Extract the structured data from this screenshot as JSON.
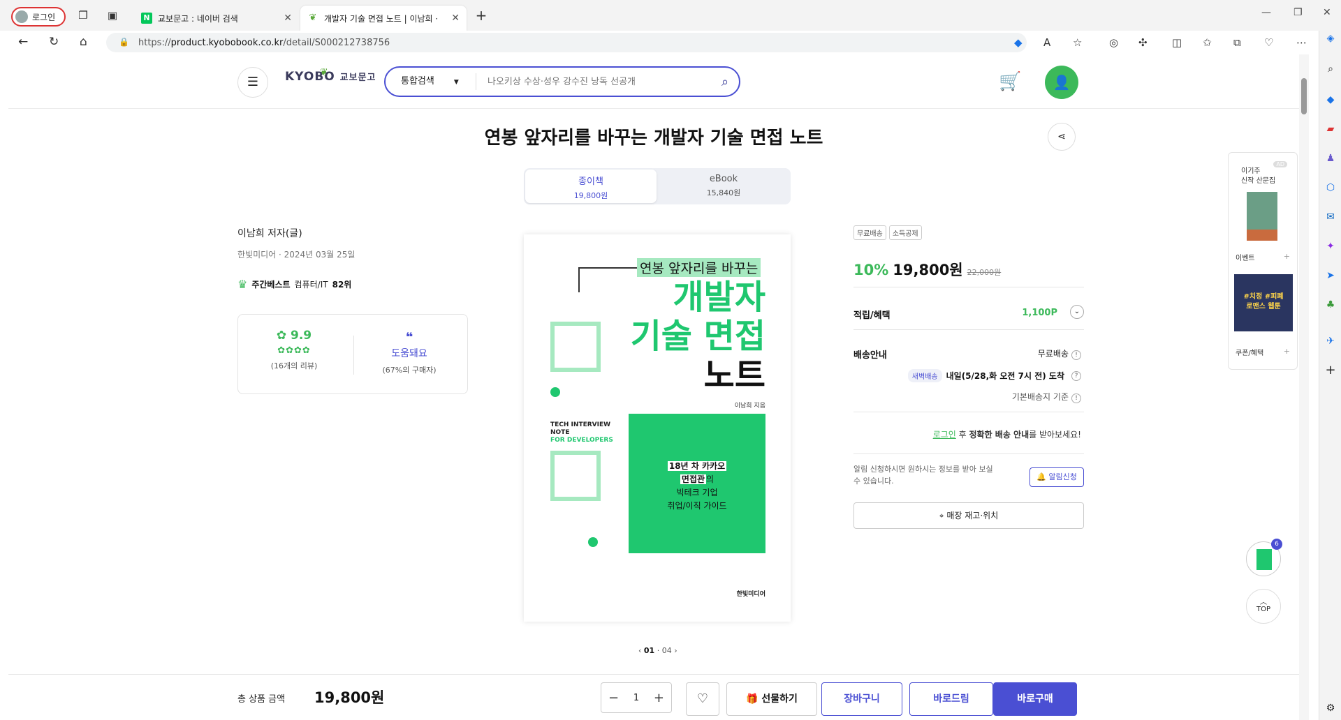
{
  "browser": {
    "profile_label": "로그인",
    "tabs": [
      {
        "label": "교보문고 : 네이버 검색",
        "favicon": "N"
      },
      {
        "label": "개발자 기술 면접 노트 | 이남희 ·",
        "favicon": "kyobo-leaf"
      }
    ],
    "url_prefix": "https://",
    "url_host": "product.kyobobook.co.kr",
    "url_path": "/detail/S000212738756"
  },
  "header": {
    "logo_en": "KYOBO",
    "logo_ko": "교보문고",
    "search_category": "통합검색",
    "search_placeholder": "나오키상 수상·성우 강수진 낭독 선공개"
  },
  "product": {
    "title": "연봉 앞자리를 바꾸는 개발자 기술 면접 노트",
    "formats": [
      {
        "label": "종이책",
        "price": "19,800원"
      },
      {
        "label": "eBook",
        "price": "15,840원"
      }
    ],
    "author": "이남희 저자(글)",
    "publisher_date": "한빛미디어 · 2024년 03월 25일",
    "bestseller_label": "주간베스트",
    "bestseller_category": "컴퓨터/IT",
    "bestseller_rank": "82위",
    "rating_score": "9.9",
    "review_count": "(16개의 리뷰)",
    "helpful_label": "도움돼요",
    "helpful_pct": "(67%의 구매자)",
    "page_indicator_current": "01",
    "page_indicator_total": "04"
  },
  "cover": {
    "highlight": "연봉 앞자리를 바꾸는",
    "line1": "개발자",
    "line2": "기술 면접",
    "line3": "노트",
    "author_small": "이남희 지음",
    "en1": "TECH INTERVIEW",
    "en2": "NOTE",
    "en3": "FOR DEVELOPERS",
    "green1": "18년 차 카카오",
    "green2a": "면접관",
    "green2b": "의",
    "green3": "빅테크 기업",
    "green4": "취업/이직 가이드",
    "publisher": "한빛미디어"
  },
  "purchase": {
    "tags": [
      "무료배송",
      "소득공제"
    ],
    "discount": "10%",
    "price": "19,800원",
    "original_price": "22,000원",
    "points_label": "적립/혜택",
    "points_value": "1,100P",
    "shipping_label": "배송안내",
    "shipping_free": "무료배송",
    "dawn_badge": "새벽배송",
    "dawn_text": "내일(5/28,화 오전 7시 전) 도착",
    "base_address": "기본배송지 기준",
    "login_link": "로그인",
    "login_note_mid": " 후 ",
    "login_note_bold": "정확한 배송 안내",
    "login_note_end": "를 받아보세요!",
    "alert_text": "알림 신청하시면 원하시는 정보를 받아 보실 수 있습니다.",
    "alert_button": "알림신청",
    "store_button": "매장 재고·위치"
  },
  "rail": {
    "title_line1": "이기주",
    "title_line2": "신작 산문집",
    "ad": "AD",
    "event_label": "이벤트",
    "promo_line1": "#치정 #피폐",
    "promo_line2": "로맨스 웹툰",
    "coupon_label": "쿠폰/혜택",
    "float_count": "6",
    "top_label": "TOP"
  },
  "bottom": {
    "total_label": "총 상품 금액",
    "total_value": "19,800원",
    "quantity": "1",
    "gift_label": "선물하기",
    "cart_label": "장바구니",
    "drim_label": "바로드림",
    "buy_label": "바로구매"
  },
  "colors": {
    "brand_blue": "#4a4fd3",
    "brand_green": "#3cb95a",
    "cover_green": "#1fc76f"
  }
}
